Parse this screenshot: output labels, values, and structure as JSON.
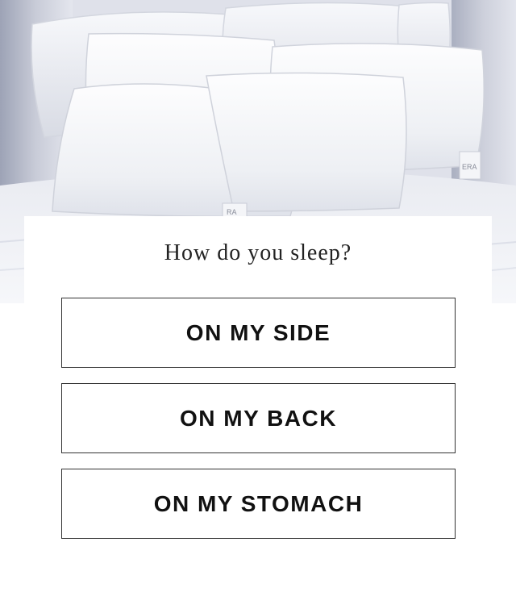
{
  "hero": {
    "image": "pillows-on-bed",
    "pillow_tag_1": "RA",
    "pillow_tag_2": "ERA"
  },
  "quiz": {
    "question": "How do you sleep?",
    "options": [
      {
        "label": "ON MY SIDE"
      },
      {
        "label": "ON MY BACK"
      },
      {
        "label": "ON MY STOMACH"
      }
    ]
  },
  "colors": {
    "background": "#ffffff",
    "text": "#111111",
    "border": "#333333"
  }
}
